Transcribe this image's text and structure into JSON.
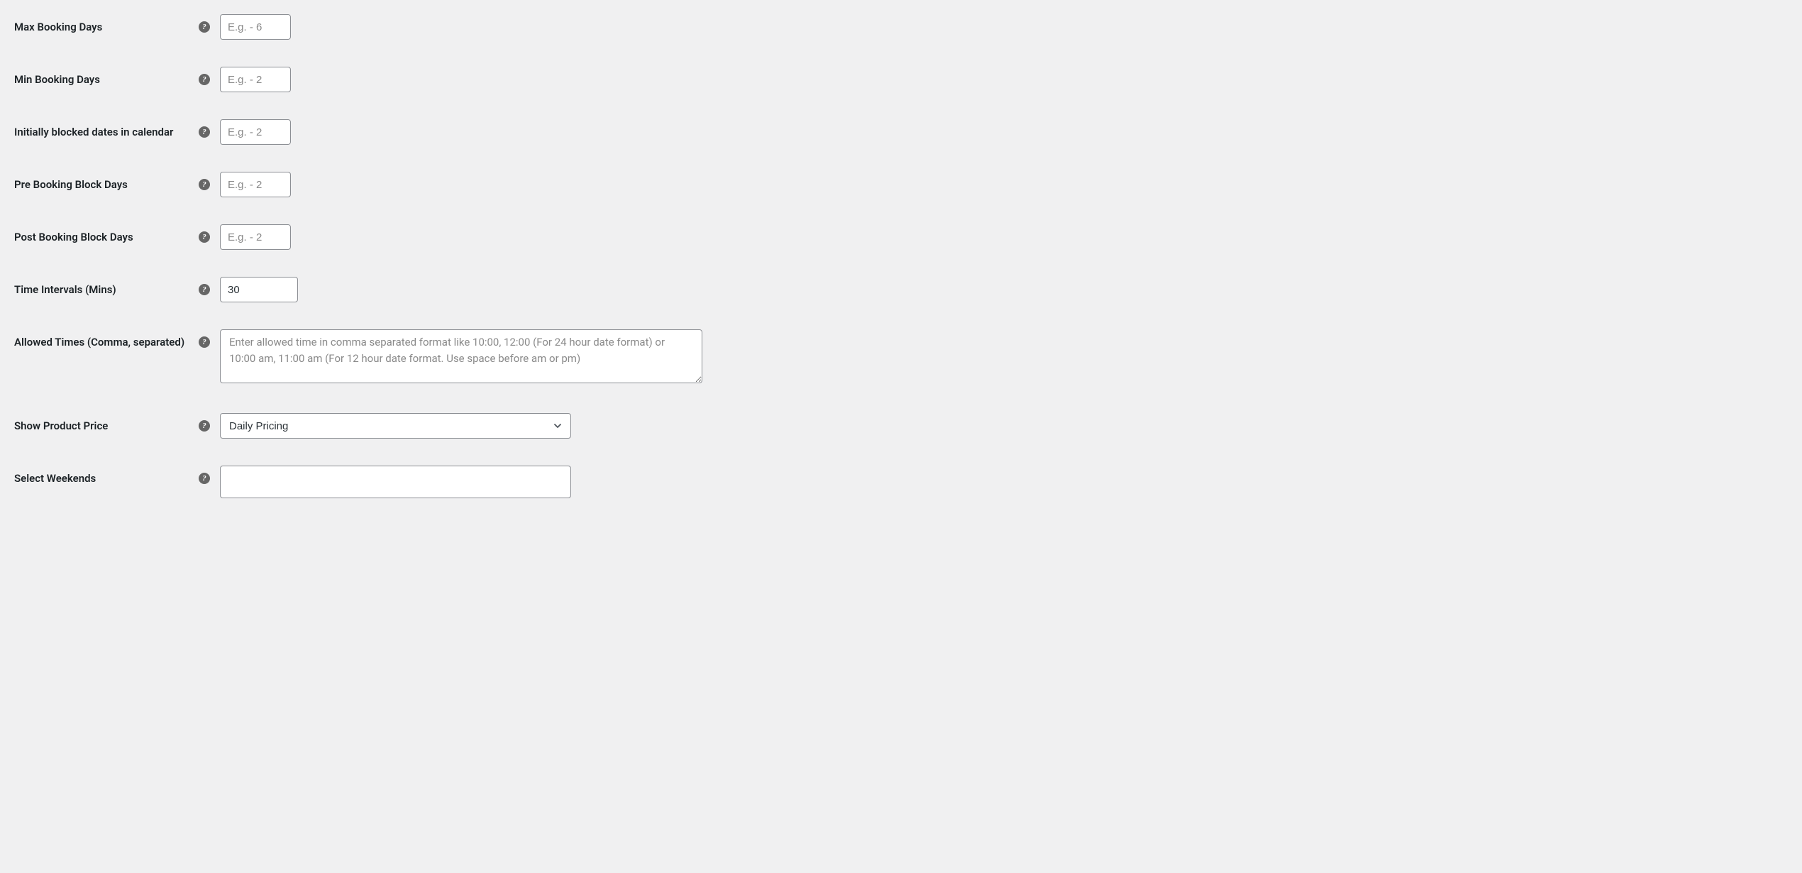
{
  "fields": {
    "max_booking_days": {
      "label": "Max Booking Days",
      "placeholder": "E.g. - 6",
      "value": ""
    },
    "min_booking_days": {
      "label": "Min Booking Days",
      "placeholder": "E.g. - 2",
      "value": ""
    },
    "initially_blocked": {
      "label": "Initially blocked dates in calendar",
      "placeholder": "E.g. - 2",
      "value": ""
    },
    "pre_booking_block": {
      "label": "Pre Booking Block Days",
      "placeholder": "E.g. - 2",
      "value": ""
    },
    "post_booking_block": {
      "label": "Post Booking Block Days",
      "placeholder": "E.g. - 2",
      "value": ""
    },
    "time_intervals": {
      "label": "Time Intervals (Mins)",
      "placeholder": "",
      "value": "30"
    },
    "allowed_times": {
      "label": "Allowed Times (Comma, separated)",
      "placeholder": "Enter allowed time in comma separated format like 10:00, 12:00 (For 24 hour date format) or 10:00 am, 11:00 am (For 12 hour date format. Use space before am or pm)",
      "value": ""
    },
    "show_product_price": {
      "label": "Show Product Price",
      "selected": "Daily Pricing"
    },
    "select_weekends": {
      "label": "Select Weekends",
      "value": ""
    }
  },
  "help_symbol": "?"
}
